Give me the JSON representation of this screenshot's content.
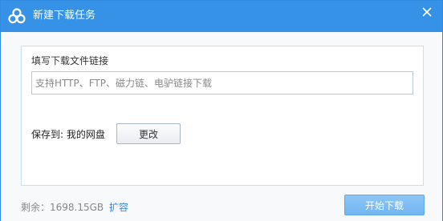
{
  "window": {
    "title": "新建下载任务",
    "app_icon": "cloud-logo-icon",
    "close_icon": "close-icon"
  },
  "form": {
    "url_label": "填写下载文件链接",
    "url_value": "",
    "url_placeholder": "支持HTTP、FTP、磁力链、电驴链接下载",
    "save_to_label": "保存到: 我的网盘",
    "change_button": "更改"
  },
  "footer": {
    "remaining_space": "剩余：1698.15GB",
    "expand_link": "扩容",
    "start_button": "开始下载"
  },
  "colors": {
    "titlebar": "#3592e6",
    "link": "#3b86d6",
    "primary_button": "#7fbef3"
  }
}
